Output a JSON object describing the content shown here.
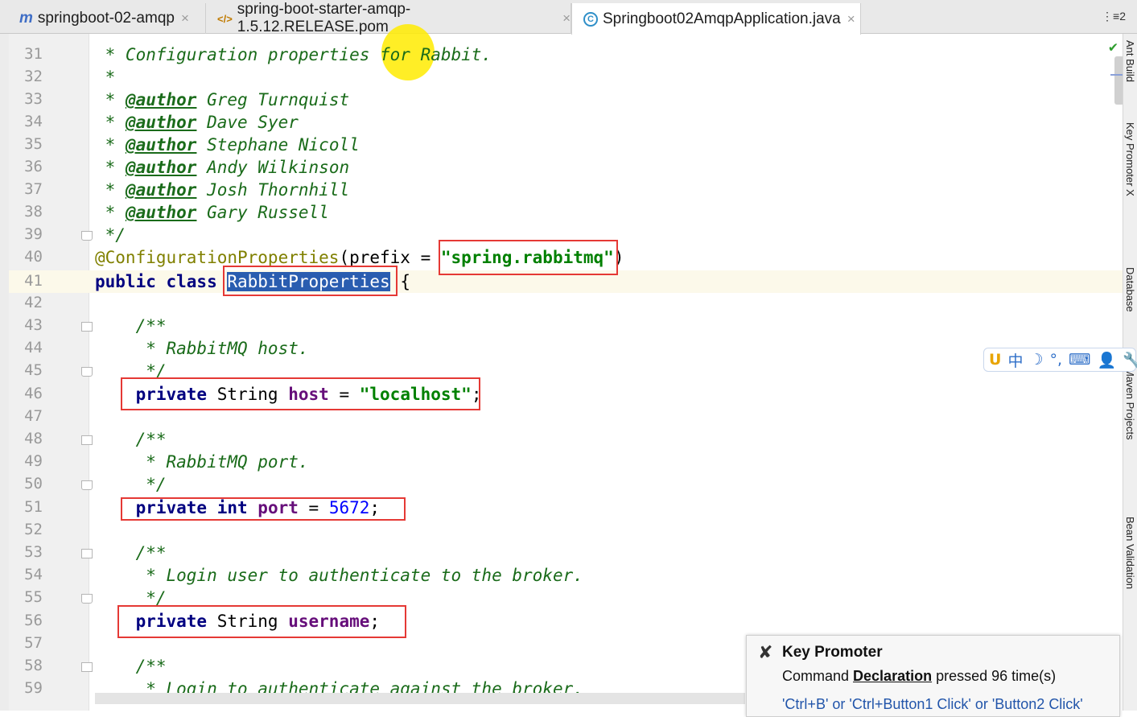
{
  "tabs": [
    {
      "icon": "m",
      "label": "springboot-02-amqp",
      "close": "×"
    },
    {
      "icon": "</>",
      "label": "spring-boot-starter-amqp-1.5.12.RELEASE.pom",
      "close": "×"
    },
    {
      "icon": "C",
      "label": "Springboot02AmqpApplication.java",
      "close": "×"
    }
  ],
  "tab_menu": "⋮≡2",
  "line_numbers": [
    "31",
    "32",
    "33",
    "34",
    "35",
    "36",
    "37",
    "38",
    "39",
    "40",
    "41",
    "42",
    "43",
    "44",
    "45",
    "46",
    "47",
    "48",
    "49",
    "50",
    "51",
    "52",
    "53",
    "54",
    "55",
    "56",
    "57",
    "58",
    "59"
  ],
  "code": {
    "l31": " * Configuration properties for Rabbit.",
    "l32": " *",
    "l33_star": " * ",
    "l33_tag": "@author",
    "l33_name": " Greg Turnquist",
    "l34_star": " * ",
    "l34_tag": "@author",
    "l34_name": " Dave Syer",
    "l35_star": " * ",
    "l35_tag": "@author",
    "l35_name": " Stephane Nicoll",
    "l36_star": " * ",
    "l36_tag": "@author",
    "l36_name": " Andy Wilkinson",
    "l37_star": " * ",
    "l37_tag": "@author",
    "l37_name": " Josh Thornhill",
    "l38_star": " * ",
    "l38_tag": "@author",
    "l38_name": " Gary Russell",
    "l39": " */",
    "l40_ann": "@ConfigurationProperties",
    "l40_mid": "(prefix = ",
    "l40_str": "\"spring.rabbitmq\"",
    "l40_end": ")",
    "l41_kw": "public class ",
    "l41_sel": "RabbitProperties",
    "l41_end": " {",
    "l43": "    /**",
    "l44": "     * RabbitMQ host.",
    "l45": "     */",
    "l46_kw": "    private ",
    "l46_type": "String ",
    "l46_fld": "host",
    "l46_mid": " = ",
    "l46_str": "\"localhost\"",
    "l46_end": ";",
    "l48": "    /**",
    "l49": "     * RabbitMQ port.",
    "l50": "     */",
    "l51_kw": "    private int ",
    "l51_fld": "port",
    "l51_mid": " = ",
    "l51_num": "5672",
    "l51_end": ";",
    "l53": "    /**",
    "l54": "     * Login user to authenticate to the broker.",
    "l55": "     */",
    "l56_kw": "    private ",
    "l56_type": "String ",
    "l56_fld": "username",
    "l56_end": ";",
    "l58": "    /**",
    "l59": "     * Login to authenticate against the broker."
  },
  "right_tools": [
    "Ant Build",
    "Key Promoter X",
    "Database",
    "Maven Projects",
    "Bean Validation"
  ],
  "ime_toolbar": [
    "中",
    "☽",
    "°,",
    "⌨",
    "👤",
    "🔧"
  ],
  "key_promoter": {
    "title": "Key Promoter",
    "body_prefix": "Command ",
    "command": "Declaration",
    "body_suffix": " pressed 96 time(s)",
    "shortcuts": "'Ctrl+B' or 'Ctrl+Button1 Click' or 'Button2 Click'"
  },
  "colors": {
    "highlight_box": "#e53935",
    "selection": "#2a5db0",
    "cursor_highlight": "#ffeb00"
  }
}
